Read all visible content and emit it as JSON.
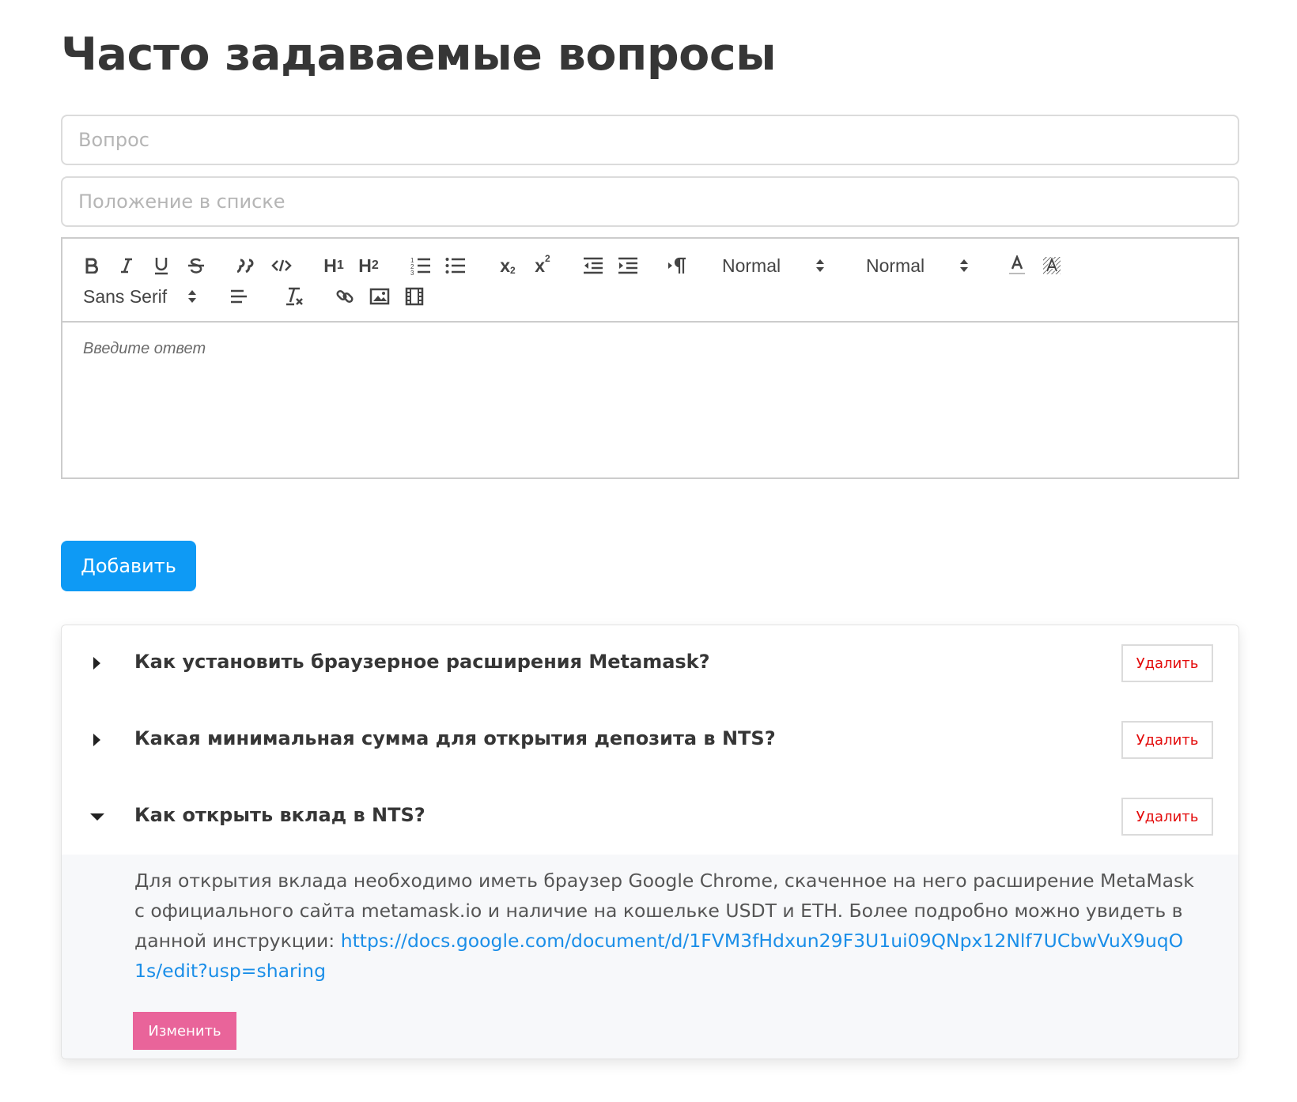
{
  "page": {
    "title": "Часто задаваемые вопросы"
  },
  "form": {
    "question_placeholder": "Вопрос",
    "position_placeholder": "Положение в списке",
    "editor_placeholder": "Введите ответ",
    "add_label": "Добавить"
  },
  "toolbar": {
    "header_select": "Normal",
    "size_select": "Normal",
    "font_select": "Sans Serif",
    "icons": [
      "bold-icon",
      "italic-icon",
      "underline-icon",
      "strike-icon",
      "blockquote-icon",
      "code-block-icon",
      "header-1-icon",
      "header-2-icon",
      "ordered-list-icon",
      "bullet-list-icon",
      "subscript-icon",
      "superscript-icon",
      "outdent-icon",
      "indent-icon",
      "rtl-direction-icon",
      "text-color-icon",
      "background-color-icon",
      "align-icon",
      "clear-format-icon",
      "link-icon",
      "image-icon",
      "video-icon"
    ]
  },
  "faq": {
    "items": [
      {
        "question": "Как установить браузерное расширения Metamask?",
        "delete_label": "Удалить",
        "expanded": false
      },
      {
        "question": "Какая минимальная сумма для открытия депозита в NTS?",
        "delete_label": "Удалить",
        "expanded": false
      },
      {
        "question": "Как открыть вклад в NTS?",
        "delete_label": "Удалить",
        "expanded": true,
        "answer_text": "Для открытия вклада необходимо иметь браузер Google Chrome, скаченное на него расширение MetaMask с официального сайта metamask.io и наличие на кошельке USDT и ETH. Более подробно можно увидеть в данной инструкции: ",
        "answer_link": "https://docs.google.com/document/d/1FVM3fHdxun29F3U1ui09QNpx12Nlf7UCbwVuX9uqO1s/edit?usp=sharing",
        "edit_label": "Изменить"
      }
    ]
  },
  "colors": {
    "primary": "#0e9af5",
    "danger": "#e30a0a",
    "edit": "#e9649a",
    "link": "#1a8ee8"
  }
}
